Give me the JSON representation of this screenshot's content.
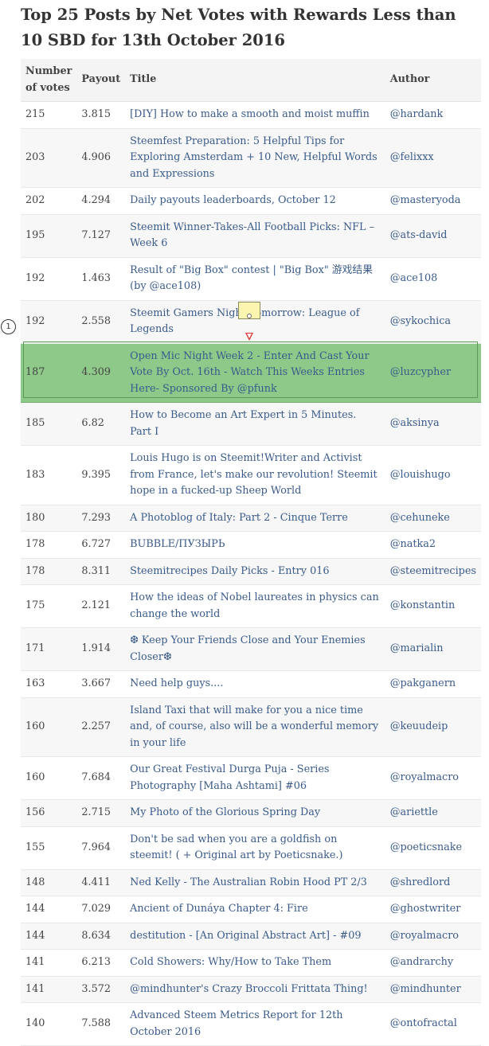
{
  "page": {
    "title": "Top 25 Posts by Net Votes with Rewards Less than 10 SBD for 13th October 2016"
  },
  "table": {
    "headers": [
      "Number of votes",
      "Payout",
      "Title",
      "Author"
    ],
    "rows": [
      {
        "votes": "215",
        "payout": "3.815",
        "title": "[DIY] How to make a smooth and moist muffin",
        "author": "@hardank"
      },
      {
        "votes": "203",
        "payout": "4.906",
        "title": "Steemfest Preparation: 5 Helpful Tips for Exploring Amsterdam + 10 New, Helpful Words and Expressions",
        "author": "@felixxx"
      },
      {
        "votes": "202",
        "payout": "4.294",
        "title": "Daily payouts leaderboards, October 12",
        "author": "@masteryoda"
      },
      {
        "votes": "195",
        "payout": "7.127",
        "title": "Steemit Winner-Takes-All Football Picks: NFL – Week 6",
        "author": "@ats-david"
      },
      {
        "votes": "192",
        "payout": "1.463",
        "title": "Result of \"Big Box\" contest | \"Big Box\" 游戏结果 (by @ace108)",
        "author": "@ace108"
      },
      {
        "votes": "192",
        "payout": "2.558",
        "title": "Steemit Gamers Night Tomorrow: League of Legends",
        "author": "@sykochica"
      },
      {
        "votes": "187",
        "payout": "4.309",
        "title": "Open Mic Night Week 2 - Enter And Cast Your Vote By Oct. 16th - Watch This Weeks Entries Here- Sponsored By @pfunk",
        "author": "@luzcypher"
      },
      {
        "votes": "185",
        "payout": "6.82",
        "title": "How to Become an Art Expert in 5 Minutes. Part I",
        "author": "@aksinya"
      },
      {
        "votes": "183",
        "payout": "9.395",
        "title": "Louis Hugo is on Steemit!Writer and Activist from France, let's make our revolution! Steemit hope in a fucked-up Sheep World",
        "author": "@louishugo"
      },
      {
        "votes": "180",
        "payout": "7.293",
        "title": "A Photoblog of Italy: Part 2 - Cinque Terre",
        "author": "@cehuneke"
      },
      {
        "votes": "178",
        "payout": "6.727",
        "title": "BUBBLE/ПУЗЫРЬ",
        "author": "@natka2"
      },
      {
        "votes": "178",
        "payout": "8.311",
        "title": "Steemitrecipes Daily Picks - Entry 016",
        "author": "@steemitrecipes"
      },
      {
        "votes": "175",
        "payout": "2.121",
        "title": "How the ideas of Nobel laureates in physics can change the world",
        "author": "@konstantin"
      },
      {
        "votes": "171",
        "payout": "1.914",
        "title": "❆ Keep Your Friends Close and Your Enemies Closer❆",
        "author": "@marialin"
      },
      {
        "votes": "163",
        "payout": "3.667",
        "title": "Need help guys....",
        "author": "@pakganern"
      },
      {
        "votes": "160",
        "payout": "2.257",
        "title": "Island Taxi that will make for you a nice time and, of course, also will be a wonderful memory in your life",
        "author": "@keuudeip"
      },
      {
        "votes": "160",
        "payout": "7.684",
        "title": "Our Great Festival Durga Puja - Series Photography [Maha Ashtami] #06",
        "author": "@royalmacro"
      },
      {
        "votes": "156",
        "payout": "2.715",
        "title": "My Photo of the Glorious Spring Day",
        "author": "@ariettle"
      },
      {
        "votes": "155",
        "payout": "7.964",
        "title": "Don't be sad when you are a goldfish on steemit! ( + Original art by Poeticsnake.)",
        "author": "@poeticsnake"
      },
      {
        "votes": "148",
        "payout": "4.411",
        "title": "Ned Kelly - The Australian Robin Hood PT 2/3",
        "author": "@shredlord"
      },
      {
        "votes": "144",
        "payout": "7.029",
        "title": "Ancient of Dunáya Chapter 4: Fire",
        "author": "@ghostwriter"
      },
      {
        "votes": "144",
        "payout": "8.634",
        "title": "destitution - [An Original Abstract Art] - #09",
        "author": "@royalmacro"
      },
      {
        "votes": "141",
        "payout": "6.213",
        "title": "Cold Showers: Why/How to Take Them",
        "author": "@andrarchy"
      },
      {
        "votes": "141",
        "payout": "3.572",
        "title": "@mindhunter's Crazy Broccoli Frittata Thing!",
        "author": "@mindhunter"
      },
      {
        "votes": "140",
        "payout": "7.588",
        "title": "Advanced Steem Metrics Report for 12th October 2016",
        "author": "@ontofractal"
      }
    ]
  },
  "highlight_row": 6,
  "annotation_marker": {
    "label": "1"
  },
  "icons": {
    "note": "sticky-note-icon",
    "pin": "pin-icon"
  },
  "colors": {
    "link": "#3a5b8a",
    "highlight": "#8ec98a",
    "header_bg": "#f4f4f4"
  }
}
